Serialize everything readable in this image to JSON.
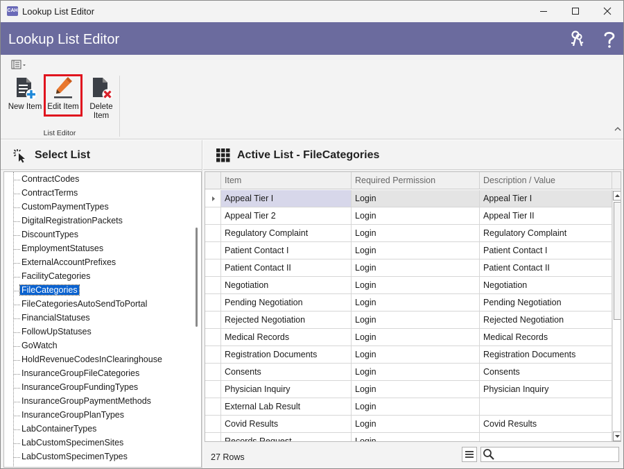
{
  "window": {
    "title": "Lookup List Editor",
    "app_icon_text": "CAH"
  },
  "header": {
    "title": "Lookup List Editor",
    "icons": [
      "keys-icon",
      "help-icon"
    ]
  },
  "ribbon": {
    "buttons": [
      {
        "label": "New Item",
        "icon": "new-item-icon"
      },
      {
        "label": "Edit Item",
        "icon": "edit-item-icon"
      },
      {
        "label_line1": "Delete",
        "label_line2": "Item",
        "icon": "delete-item-icon"
      }
    ],
    "group_label": "List Editor",
    "highlight_color": "#e0141e"
  },
  "select_list": {
    "title": "Select List",
    "items": [
      "ContractCodes",
      "ContractTerms",
      "CustomPaymentTypes",
      "DigitalRegistrationPackets",
      "DiscountTypes",
      "EmploymentStatuses",
      "ExternalAccountPrefixes",
      "FacilityCategories",
      "FileCategories",
      "FileCategoriesAutoSendToPortal",
      "FinancialStatuses",
      "FollowUpStatuses",
      "GoWatch",
      "HoldRevenueCodesInClearinghouse",
      "InsuranceGroupFileCategories",
      "InsuranceGroupFundingTypes",
      "InsuranceGroupPaymentMethods",
      "InsuranceGroupPlanTypes",
      "LabContainerTypes",
      "LabCustomSpecimenSites",
      "LabCustomSpecimenTypes"
    ],
    "selected": "FileCategories",
    "selection_color": "#0a62d0"
  },
  "active_list": {
    "title": "Active List - FileCategories",
    "columns": [
      "Item",
      "Required Permission",
      "Description / Value"
    ],
    "rows": [
      [
        "Appeal Tier I",
        "Login",
        "Appeal Tier I"
      ],
      [
        "Appeal Tier 2",
        "Login",
        "Appeal Tier II"
      ],
      [
        "Regulatory Complaint",
        "Login",
        "Regulatory Complaint"
      ],
      [
        "Patient Contact I",
        "Login",
        "Patient Contact I"
      ],
      [
        "Patient Contact II",
        "Login",
        "Patient Contact II"
      ],
      [
        "Negotiation",
        "Login",
        "Negotiation"
      ],
      [
        "Pending Negotiation",
        "Login",
        "Pending Negotiation"
      ],
      [
        "Rejected Negotiation",
        "Login",
        "Rejected Negotiation"
      ],
      [
        "Medical Records",
        "Login",
        "Medical Records"
      ],
      [
        "Registration Documents",
        "Login",
        "Registration Documents"
      ],
      [
        "Consents",
        "Login",
        "Consents"
      ],
      [
        "Physician Inquiry",
        "Login",
        "Physician Inquiry"
      ],
      [
        "External Lab Result",
        "Login",
        ""
      ],
      [
        "Covid Results",
        "Login",
        "Covid Results"
      ],
      [
        "Records Request",
        "Login",
        ""
      ]
    ],
    "row_count_label": "27 Rows",
    "search_value": "",
    "header_color": "#6b6b9e"
  }
}
